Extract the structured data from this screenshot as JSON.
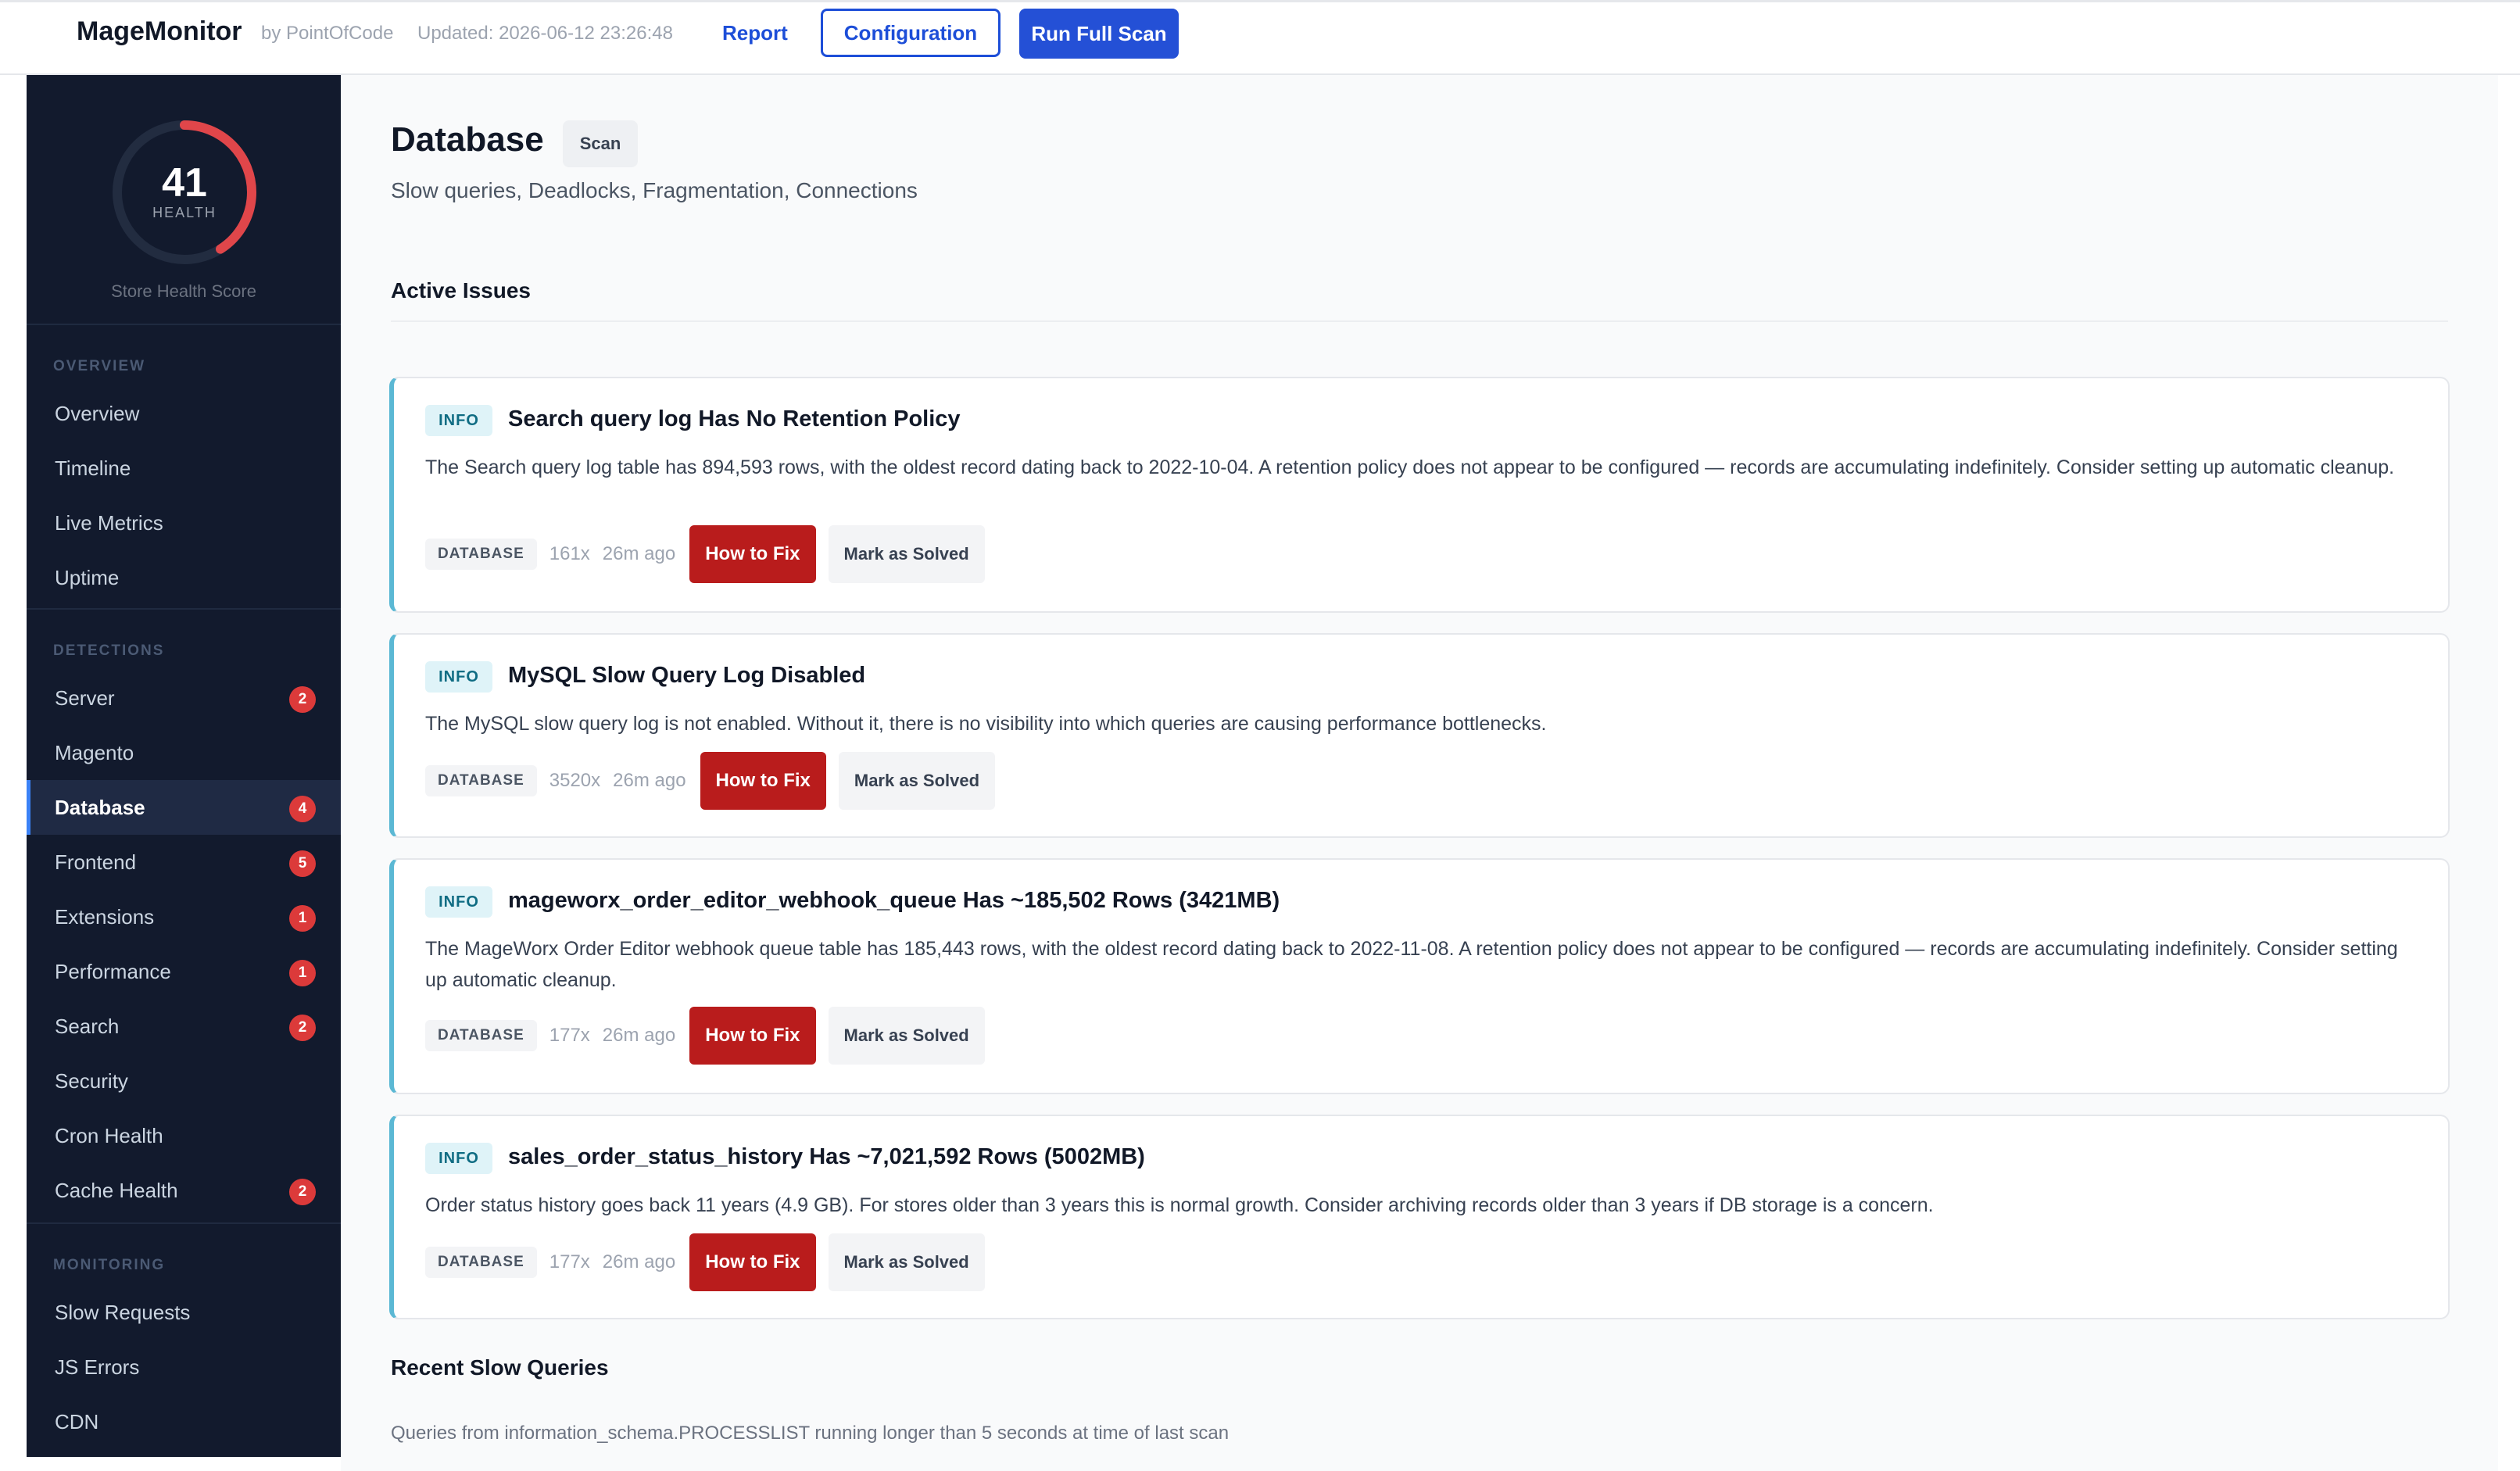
{
  "header": {
    "app_name": "MageMonitor",
    "byline": "by PointOfCode",
    "updated": "Updated: 2026-06-12 23:26:48",
    "report_label": "Report",
    "configuration_label": "Configuration",
    "run_scan_label": "Run Full Scan"
  },
  "health": {
    "score": "41",
    "score_fraction": 0.41,
    "label": "HEALTH",
    "caption": "Store Health Score",
    "arc_color": "#e0464a"
  },
  "sidebar": {
    "sections": {
      "overview": "OVERVIEW",
      "detections": "DETECTIONS",
      "monitoring": "MONITORING"
    },
    "overview_items": [
      {
        "label": "Overview"
      },
      {
        "label": "Timeline"
      },
      {
        "label": "Live Metrics"
      },
      {
        "label": "Uptime"
      }
    ],
    "detection_items": [
      {
        "label": "Server",
        "badge": "2"
      },
      {
        "label": "Magento",
        "badge": ""
      },
      {
        "label": "Database",
        "badge": "4",
        "active": true
      },
      {
        "label": "Frontend",
        "badge": "5"
      },
      {
        "label": "Extensions",
        "badge": "1"
      },
      {
        "label": "Performance",
        "badge": "1"
      },
      {
        "label": "Search",
        "badge": "2"
      },
      {
        "label": "Security",
        "badge": ""
      },
      {
        "label": "Cron Health",
        "badge": ""
      },
      {
        "label": "Cache Health",
        "badge": "2"
      }
    ],
    "monitoring_items": [
      {
        "label": "Slow Requests"
      },
      {
        "label": "JS Errors"
      },
      {
        "label": "CDN"
      }
    ]
  },
  "page": {
    "title": "Database",
    "scan_tag": "Scan",
    "subtitle": "Slow queries, Deadlocks, Fragmentation, Connections",
    "active_issues_heading": "Active Issues",
    "recent_heading": "Recent Slow Queries",
    "recent_note": "Queries from information_schema.PROCESSLIST running longer than 5 seconds at time of last scan"
  },
  "issues": [
    {
      "level": "INFO",
      "title": "Search query log Has No Retention Policy",
      "description": "The Search query log table has 894,593 rows, with the oldest record dating back to 2022-10-04. A retention policy does not appear to be configured — records are accumulating indefinitely. Consider setting up automatic cleanup.",
      "category": "DATABASE",
      "count": "161x",
      "ago": "26m ago",
      "fix_label": "How to Fix",
      "solved_label": "Mark as Solved"
    },
    {
      "level": "INFO",
      "title": "MySQL Slow Query Log Disabled",
      "description": "The MySQL slow query log is not enabled. Without it, there is no visibility into which queries are causing performance bottlenecks.",
      "category": "DATABASE",
      "count": "3520x",
      "ago": "26m ago",
      "fix_label": "How to Fix",
      "solved_label": "Mark as Solved"
    },
    {
      "level": "INFO",
      "title": "mageworx_order_editor_webhook_queue Has ~185,502 Rows (3421MB)",
      "description": "The MageWorx Order Editor webhook queue table has 185,443 rows, with the oldest record dating back to 2022-11-08. A retention policy does not appear to be configured — records are accumulating indefinitely. Consider setting up automatic cleanup.",
      "category": "DATABASE",
      "count": "177x",
      "ago": "26m ago",
      "fix_label": "How to Fix",
      "solved_label": "Mark as Solved"
    },
    {
      "level": "INFO",
      "title": "sales_order_status_history Has ~7,021,592 Rows (5002MB)",
      "description": "Order status history goes back 11 years (4.9 GB). For stores older than 3 years this is normal growth. Consider archiving records older than 3 years if DB storage is a concern.",
      "category": "DATABASE",
      "count": "177x",
      "ago": "26m ago",
      "fix_label": "How to Fix",
      "solved_label": "Mark as Solved"
    }
  ]
}
